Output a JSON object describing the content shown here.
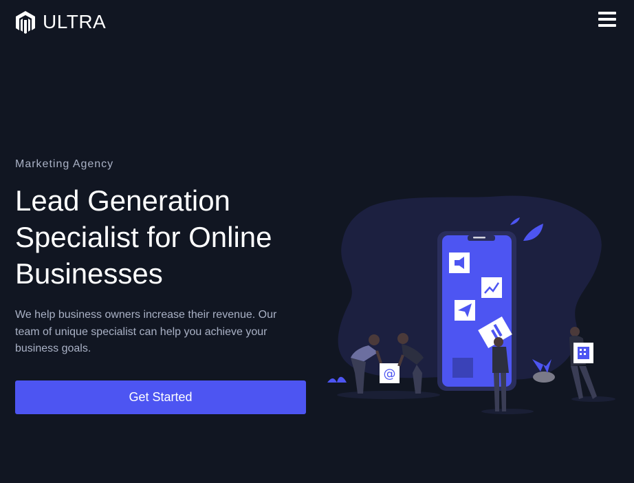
{
  "header": {
    "brand_name": "ULTRA",
    "logo_icon": "magento-style-logo-icon",
    "menu_icon": "hamburger-menu-icon"
  },
  "hero": {
    "eyebrow": "Marketing Agency",
    "headline": "Lead Generation Specialist for Online Businesses",
    "description": "We help business owners increase their revenue. Our team of unique specialist can help you achieve your business goals.",
    "cta_label": "Get Started"
  },
  "illustration": {
    "icons": [
      "megaphone-icon",
      "chart-icon",
      "paper-plane-icon",
      "at-sign-icon",
      "building-icon",
      "leaf-icon"
    ]
  },
  "colors": {
    "background": "#111622",
    "accent": "#4d55f2",
    "muted_text": "#aab2c6",
    "blob": "#1c2040"
  }
}
